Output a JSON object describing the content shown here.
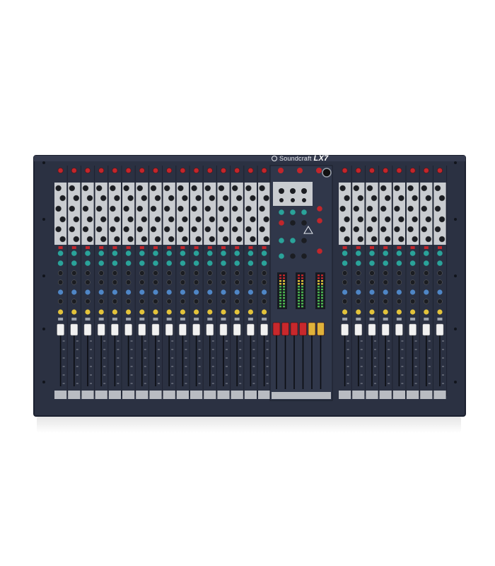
{
  "product": {
    "brand": "Soundcraft",
    "model": "LX7"
  },
  "colors": {
    "chassis": "#2b3142",
    "chassis_edge": "#1c2130",
    "eq_panel": "#c9ccd0",
    "knob_dark": "#1b1d22",
    "knob_red": "#c2262b",
    "knob_teal": "#2aa39a",
    "knob_blue": "#4f86c6",
    "knob_yellow": "#e3c33a",
    "fader_cap_white": "#f1f1f1",
    "fader_cap_red": "#c8282c",
    "fader_cap_yellow": "#e0b23a",
    "meter_led": "#4bb34f"
  },
  "layout_meta": {
    "left_channels": 16,
    "right_channels": 8,
    "master_faders": 6
  }
}
